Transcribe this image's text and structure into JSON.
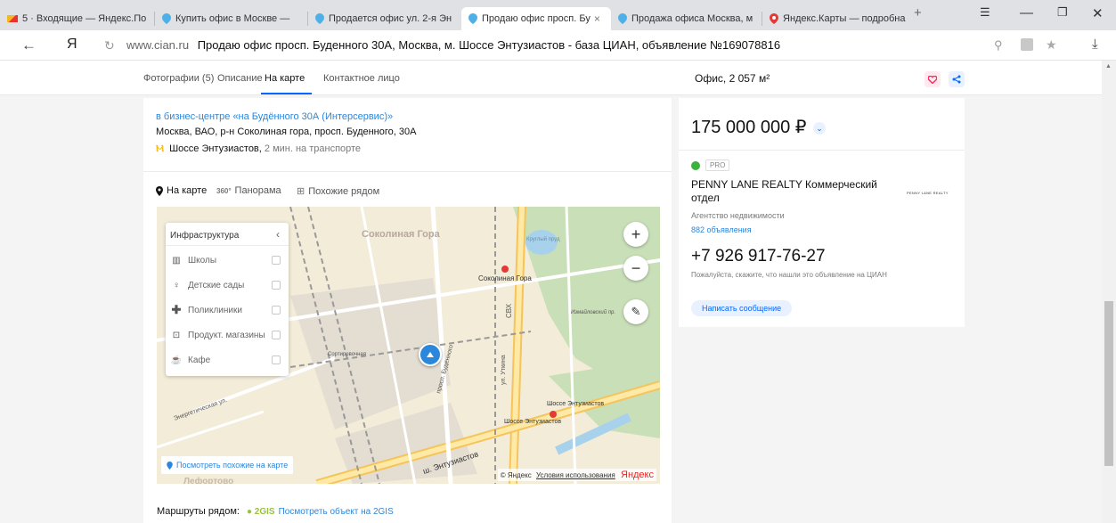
{
  "browser": {
    "tabs": [
      {
        "label": "5 · Входящие — Яндекс.По",
        "active": false
      },
      {
        "label": "Купить офис в Москве — ",
        "active": false
      },
      {
        "label": "Продается офис ул. 2-я Эн",
        "active": false
      },
      {
        "label": "Продаю офис просп. Бу",
        "active": true
      },
      {
        "label": "Продажа офиса Москва, м",
        "active": false
      },
      {
        "label": "Яндекс.Карты — подробна",
        "active": false
      }
    ],
    "new_tab": "+",
    "url_domain": "www.cian.ru",
    "url_title": "Продаю офис просп. Буденного 30А, Москва, м. Шоссе Энтузиастов - база ЦИАН, объявление №169078816",
    "yandex_logo": "Я"
  },
  "pagehead": {
    "tabs": [
      "Фотографии (5)",
      "Описание",
      "На карте",
      "Контактное лицо"
    ],
    "active_tab": "На карте",
    "offer_title": "Офис, 2 057 м²"
  },
  "location": {
    "bc_link": "в бизнес-центре «на Будённого 30А (Интерсервис)»",
    "address": "Москва, ВАО, р-н Соколиная гора, просп. Буденного, 30А",
    "metro": "Шоссе Энтузиастов,",
    "metro_time": "2 мин. на транспорте"
  },
  "map_tabs": [
    {
      "label": "На карте",
      "icon": "pin-icon",
      "active": true
    },
    {
      "label": "Панорама",
      "icon": "panorama-icon",
      "active": false
    },
    {
      "label": "Похожие рядом",
      "icon": "grid-icon",
      "active": false
    }
  ],
  "infra": {
    "title": "Инфраструктура",
    "items": [
      {
        "label": "Школы",
        "icon": "school-icon"
      },
      {
        "label": "Детские сады",
        "icon": "kindergarten-icon"
      },
      {
        "label": "Поликлиники",
        "icon": "clinic-icon"
      },
      {
        "label": "Продукт. магазины",
        "icon": "shop-icon"
      },
      {
        "label": "Кафе",
        "icon": "cafe-icon"
      }
    ]
  },
  "map": {
    "labels": {
      "sokolinaya": "Соколиная Гора",
      "sokolinaya2": "Соколиная Гора",
      "shosse": "Шоссе Энтузиастов",
      "shosse2": "Шоссе Энтузиастов",
      "energetic": "Энергетическая ул.",
      "lefortovo": "Лефортово",
      "svh": "СВХ",
      "sortir": "Сортировочная",
      "budennogo": "просп. Будённого",
      "shosse_road": "ш. Энтузиастов",
      "krug": "Круглый пруд",
      "utkina": "ул. Уткина",
      "izmail": "Измайловский пр."
    },
    "similar_link": "Посмотреть похожие на карте",
    "copyright": "© Яндекс",
    "terms": "Условия использования",
    "brand": "Яндекс"
  },
  "routes": {
    "label": "Маршруты рядом:",
    "gis": "2GIS",
    "link": "Посмотреть объект на 2GIS"
  },
  "offer": {
    "price": "175 000 000 ₽",
    "pro": "PRO",
    "agency": "PENNY LANE REALTY Коммерческий отдел",
    "agency_logo": "PENNY LANE REALTY",
    "agency_type": "Агентство недвижимости",
    "ads_count": "882 объявления",
    "phone": "+7 926 917-76-27",
    "phone_note": "Пожалуйста, скажите, что нашли это объявление на ЦИАН",
    "message_button": "Написать сообщение"
  }
}
